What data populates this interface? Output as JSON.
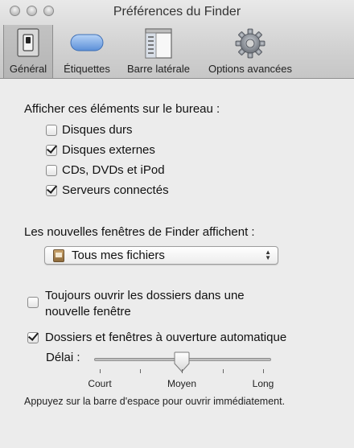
{
  "window": {
    "title": "Préférences du Finder"
  },
  "toolbar": {
    "tabs": [
      {
        "label": "Général",
        "icon": "general-switch-icon",
        "selected": true
      },
      {
        "label": "Étiquettes",
        "icon": "label-tag-icon",
        "selected": false
      },
      {
        "label": "Barre latérale",
        "icon": "sidebar-icon",
        "selected": false
      },
      {
        "label": "Options avancées",
        "icon": "gear-icon",
        "selected": false
      }
    ]
  },
  "desktop_section": {
    "heading": "Afficher ces éléments sur le bureau :",
    "items": [
      {
        "label": "Disques durs",
        "checked": false
      },
      {
        "label": "Disques externes",
        "checked": true
      },
      {
        "label": "CDs, DVDs et iPod",
        "checked": false
      },
      {
        "label": "Serveurs connectés",
        "checked": true
      }
    ]
  },
  "new_windows": {
    "heading": "Les nouvelles fenêtres de Finder affichent :",
    "selected_value": "Tous mes fichiers"
  },
  "options": {
    "open_in_new_window": {
      "line1": "Toujours ouvrir les dossiers dans une",
      "line2": "nouvelle fenêtre",
      "checked": false
    },
    "spring_loaded": {
      "label": "Dossiers et fenêtres à ouverture automatique",
      "checked": true
    }
  },
  "delay": {
    "label": "Délai :",
    "value_fraction": 0.5,
    "tick_labels": [
      "Court",
      "Moyen",
      "Long"
    ],
    "note": "Appuyez sur la barre d'espace pour ouvrir immédiatement."
  }
}
